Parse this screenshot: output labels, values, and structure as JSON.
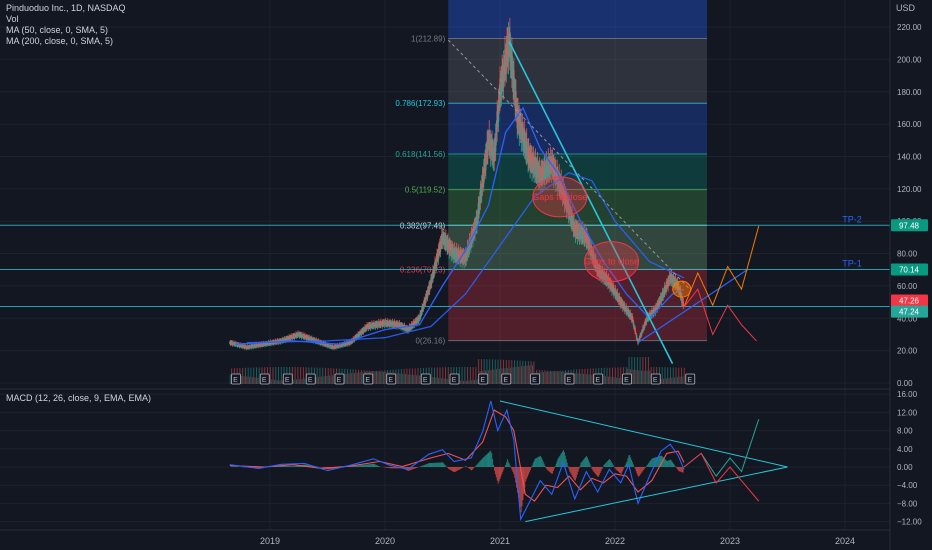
{
  "header": {
    "symbol_line": "Pinduoduo Inc., 1D, NASDAQ",
    "indicators": [
      "Vol",
      "MA (50, close, 0, SMA, 5)",
      "MA (200, close, 0, SMA, 5)"
    ],
    "macd_label": "MACD (12, 26, close, 9, EMA, EMA)",
    "currency": "USD"
  },
  "colors": {
    "background": "#131722",
    "up": "#26a69a",
    "down": "#ef5350",
    "ma50": "#2962ff",
    "ma200": "#2962ff",
    "trendline": "#26c6da",
    "macd_line": "#2962ff",
    "signal_line": "#ef5350"
  },
  "chart_data": [
    {
      "type": "line",
      "title": "Pinduoduo Inc., 1D, NASDAQ",
      "x_axis": {
        "ticks": [
          "2019",
          "2020",
          "2021",
          "2022",
          "2023",
          "2024"
        ]
      },
      "y_axis": {
        "ticks": [
          "0.00",
          "20.00",
          "40.00",
          "60.00",
          "80.00",
          "100.00",
          "120.00",
          "140.00",
          "160.00",
          "180.00",
          "200.00",
          "220.00"
        ],
        "ylim": [
          0,
          230
        ]
      },
      "price_series": [
        {
          "x": 2018.65,
          "y": 25
        },
        {
          "x": 2018.8,
          "y": 22
        },
        {
          "x": 2018.95,
          "y": 24
        },
        {
          "x": 2019.1,
          "y": 26
        },
        {
          "x": 2019.25,
          "y": 30
        },
        {
          "x": 2019.4,
          "y": 26
        },
        {
          "x": 2019.55,
          "y": 22
        },
        {
          "x": 2019.7,
          "y": 25
        },
        {
          "x": 2019.85,
          "y": 35
        },
        {
          "x": 2020.0,
          "y": 37
        },
        {
          "x": 2020.12,
          "y": 36
        },
        {
          "x": 2020.2,
          "y": 33
        },
        {
          "x": 2020.3,
          "y": 40
        },
        {
          "x": 2020.4,
          "y": 62
        },
        {
          "x": 2020.5,
          "y": 90
        },
        {
          "x": 2020.6,
          "y": 80
        },
        {
          "x": 2020.7,
          "y": 77
        },
        {
          "x": 2020.8,
          "y": 100
        },
        {
          "x": 2020.9,
          "y": 150
        },
        {
          "x": 2020.95,
          "y": 140
        },
        {
          "x": 2021.0,
          "y": 180
        },
        {
          "x": 2021.08,
          "y": 211
        },
        {
          "x": 2021.15,
          "y": 165
        },
        {
          "x": 2021.25,
          "y": 140
        },
        {
          "x": 2021.35,
          "y": 128
        },
        {
          "x": 2021.45,
          "y": 135
        },
        {
          "x": 2021.55,
          "y": 118
        },
        {
          "x": 2021.65,
          "y": 95
        },
        {
          "x": 2021.75,
          "y": 90
        },
        {
          "x": 2021.85,
          "y": 70
        },
        {
          "x": 2021.95,
          "y": 62
        },
        {
          "x": 2022.05,
          "y": 50
        },
        {
          "x": 2022.15,
          "y": 40
        },
        {
          "x": 2022.2,
          "y": 25
        },
        {
          "x": 2022.28,
          "y": 40
        },
        {
          "x": 2022.35,
          "y": 45
        },
        {
          "x": 2022.42,
          "y": 55
        },
        {
          "x": 2022.48,
          "y": 65
        },
        {
          "x": 2022.55,
          "y": 60
        },
        {
          "x": 2022.6,
          "y": 47
        }
      ],
      "ma50": [
        {
          "x": 2018.7,
          "y": 24
        },
        {
          "x": 2019.2,
          "y": 26
        },
        {
          "x": 2019.6,
          "y": 24
        },
        {
          "x": 2020.0,
          "y": 33
        },
        {
          "x": 2020.3,
          "y": 36
        },
        {
          "x": 2020.5,
          "y": 60
        },
        {
          "x": 2020.7,
          "y": 82
        },
        {
          "x": 2020.9,
          "y": 110
        },
        {
          "x": 2021.05,
          "y": 155
        },
        {
          "x": 2021.2,
          "y": 170
        },
        {
          "x": 2021.35,
          "y": 145
        },
        {
          "x": 2021.5,
          "y": 130
        },
        {
          "x": 2021.7,
          "y": 100
        },
        {
          "x": 2021.9,
          "y": 75
        },
        {
          "x": 2022.1,
          "y": 55
        },
        {
          "x": 2022.3,
          "y": 40
        },
        {
          "x": 2022.5,
          "y": 55
        },
        {
          "x": 2022.6,
          "y": 58
        }
      ],
      "ma200": [
        {
          "x": 2018.8,
          "y": 25
        },
        {
          "x": 2019.5,
          "y": 26
        },
        {
          "x": 2020.0,
          "y": 28
        },
        {
          "x": 2020.4,
          "y": 35
        },
        {
          "x": 2020.7,
          "y": 55
        },
        {
          "x": 2021.0,
          "y": 85
        },
        {
          "x": 2021.3,
          "y": 115
        },
        {
          "x": 2021.6,
          "y": 130
        },
        {
          "x": 2021.8,
          "y": 125
        },
        {
          "x": 2022.0,
          "y": 100
        },
        {
          "x": 2022.3,
          "y": 75
        },
        {
          "x": 2022.6,
          "y": 65
        }
      ],
      "fibonacci": [
        {
          "ratio": "1",
          "label": "1(212.89)",
          "value": 212.89,
          "band_color": "#787b86"
        },
        {
          "ratio": "0.786",
          "label": "0.786(172.93)",
          "value": 172.93,
          "band_color": "#2962ff"
        },
        {
          "ratio": "0.618",
          "label": "0.618(141.56)",
          "value": 141.56,
          "band_color": "#089981"
        },
        {
          "ratio": "0.5",
          "label": "0.5(119.52)",
          "value": 119.52,
          "band_color": "#4caf50"
        },
        {
          "ratio": "0.382",
          "label": "0.382(97.49)",
          "value": 97.49,
          "band_color": "#81c784"
        },
        {
          "ratio": "0.236",
          "label": "0.236(70.23)",
          "value": 70.23,
          "band_color": "#f23645"
        },
        {
          "ratio": "0",
          "label": "0(26.16)",
          "value": 26.16,
          "band_color": null
        }
      ],
      "horizontal_lines": [
        {
          "label": "TP-2",
          "value": 97.48,
          "price_label": "97.48"
        },
        {
          "label": "TP-1",
          "value": 70.14,
          "price_label": "70.14"
        },
        {
          "label": "",
          "value": 47.3,
          "price_label": ""
        }
      ],
      "price_badges": [
        {
          "label": "47.26",
          "value": 47.26,
          "color": "#f23645"
        },
        {
          "label": "47.24",
          "value": 47.24,
          "color": "#26a69a"
        }
      ],
      "annotations": [
        {
          "text": "Gaps to close",
          "x": 2021.52,
          "y": 115
        },
        {
          "text": "Gaps to close",
          "x": 2021.97,
          "y": 75
        }
      ],
      "earnings_markers": [
        2018.7,
        2018.95,
        2019.15,
        2019.35,
        2019.6,
        2019.85,
        2020.05,
        2020.35,
        2020.6,
        2020.85,
        2021.05,
        2021.3,
        2021.6,
        2021.85,
        2022.1,
        2022.35,
        2022.65
      ]
    },
    {
      "type": "line",
      "title": "MACD (12, 26, close, 9, EMA, EMA)",
      "y_axis": {
        "ticks": [
          "16.00",
          "12.00",
          "8.00",
          "4.00",
          "0.00",
          "−4.00",
          "−8.00",
          "−12.00"
        ],
        "ylim": [
          -13,
          16
        ]
      },
      "macd": [
        {
          "x": 2018.65,
          "y": 0.5
        },
        {
          "x": 2018.9,
          "y": -0.3
        },
        {
          "x": 2019.1,
          "y": 0.6
        },
        {
          "x": 2019.3,
          "y": 0.8
        },
        {
          "x": 2019.5,
          "y": -0.8
        },
        {
          "x": 2019.7,
          "y": 0.4
        },
        {
          "x": 2019.9,
          "y": 1.8
        },
        {
          "x": 2020.05,
          "y": 0.3
        },
        {
          "x": 2020.2,
          "y": -0.5
        },
        {
          "x": 2020.38,
          "y": 2.8
        },
        {
          "x": 2020.5,
          "y": 3.8
        },
        {
          "x": 2020.6,
          "y": 1.2
        },
        {
          "x": 2020.75,
          "y": 2.0
        },
        {
          "x": 2020.85,
          "y": 7.8
        },
        {
          "x": 2020.92,
          "y": 14.5
        },
        {
          "x": 2020.98,
          "y": 8.0
        },
        {
          "x": 2021.06,
          "y": 12.5
        },
        {
          "x": 2021.12,
          "y": 6.0
        },
        {
          "x": 2021.18,
          "y": -11.5
        },
        {
          "x": 2021.25,
          "y": -8.0
        },
        {
          "x": 2021.35,
          "y": -3.0
        },
        {
          "x": 2021.45,
          "y": -6.0
        },
        {
          "x": 2021.55,
          "y": 1.0
        },
        {
          "x": 2021.65,
          "y": -7.0
        },
        {
          "x": 2021.75,
          "y": -1.0
        },
        {
          "x": 2021.85,
          "y": -5.5
        },
        {
          "x": 2021.95,
          "y": -0.5
        },
        {
          "x": 2022.05,
          "y": -3.5
        },
        {
          "x": 2022.12,
          "y": 0.5
        },
        {
          "x": 2022.2,
          "y": -8.0
        },
        {
          "x": 2022.3,
          "y": -2.0
        },
        {
          "x": 2022.4,
          "y": 3.5
        },
        {
          "x": 2022.48,
          "y": 5.0
        },
        {
          "x": 2022.55,
          "y": 2.5
        },
        {
          "x": 2022.6,
          "y": -0.5
        }
      ],
      "signal": [
        {
          "x": 2018.65,
          "y": 0.3
        },
        {
          "x": 2018.95,
          "y": 0.0
        },
        {
          "x": 2019.2,
          "y": 0.5
        },
        {
          "x": 2019.45,
          "y": -0.3
        },
        {
          "x": 2019.7,
          "y": 0.2
        },
        {
          "x": 2019.95,
          "y": 1.2
        },
        {
          "x": 2020.15,
          "y": 0.1
        },
        {
          "x": 2020.4,
          "y": 2.0
        },
        {
          "x": 2020.55,
          "y": 3.0
        },
        {
          "x": 2020.7,
          "y": 1.5
        },
        {
          "x": 2020.85,
          "y": 5.5
        },
        {
          "x": 2020.95,
          "y": 12.5
        },
        {
          "x": 2021.05,
          "y": 11.0
        },
        {
          "x": 2021.12,
          "y": 8.0
        },
        {
          "x": 2021.22,
          "y": -6.0
        },
        {
          "x": 2021.3,
          "y": -7.5
        },
        {
          "x": 2021.4,
          "y": -4.0
        },
        {
          "x": 2021.5,
          "y": -4.5
        },
        {
          "x": 2021.6,
          "y": -2.0
        },
        {
          "x": 2021.7,
          "y": -5.0
        },
        {
          "x": 2021.8,
          "y": -2.5
        },
        {
          "x": 2021.9,
          "y": -3.5
        },
        {
          "x": 2022.0,
          "y": -1.5
        },
        {
          "x": 2022.1,
          "y": -2.0
        },
        {
          "x": 2022.2,
          "y": -5.5
        },
        {
          "x": 2022.32,
          "y": -3.0
        },
        {
          "x": 2022.45,
          "y": 3.0
        },
        {
          "x": 2022.55,
          "y": 3.5
        },
        {
          "x": 2022.6,
          "y": 1.0
        }
      ],
      "histogram_color_positive": "#26a69a",
      "histogram_color_negative": "#ef5350"
    }
  ]
}
